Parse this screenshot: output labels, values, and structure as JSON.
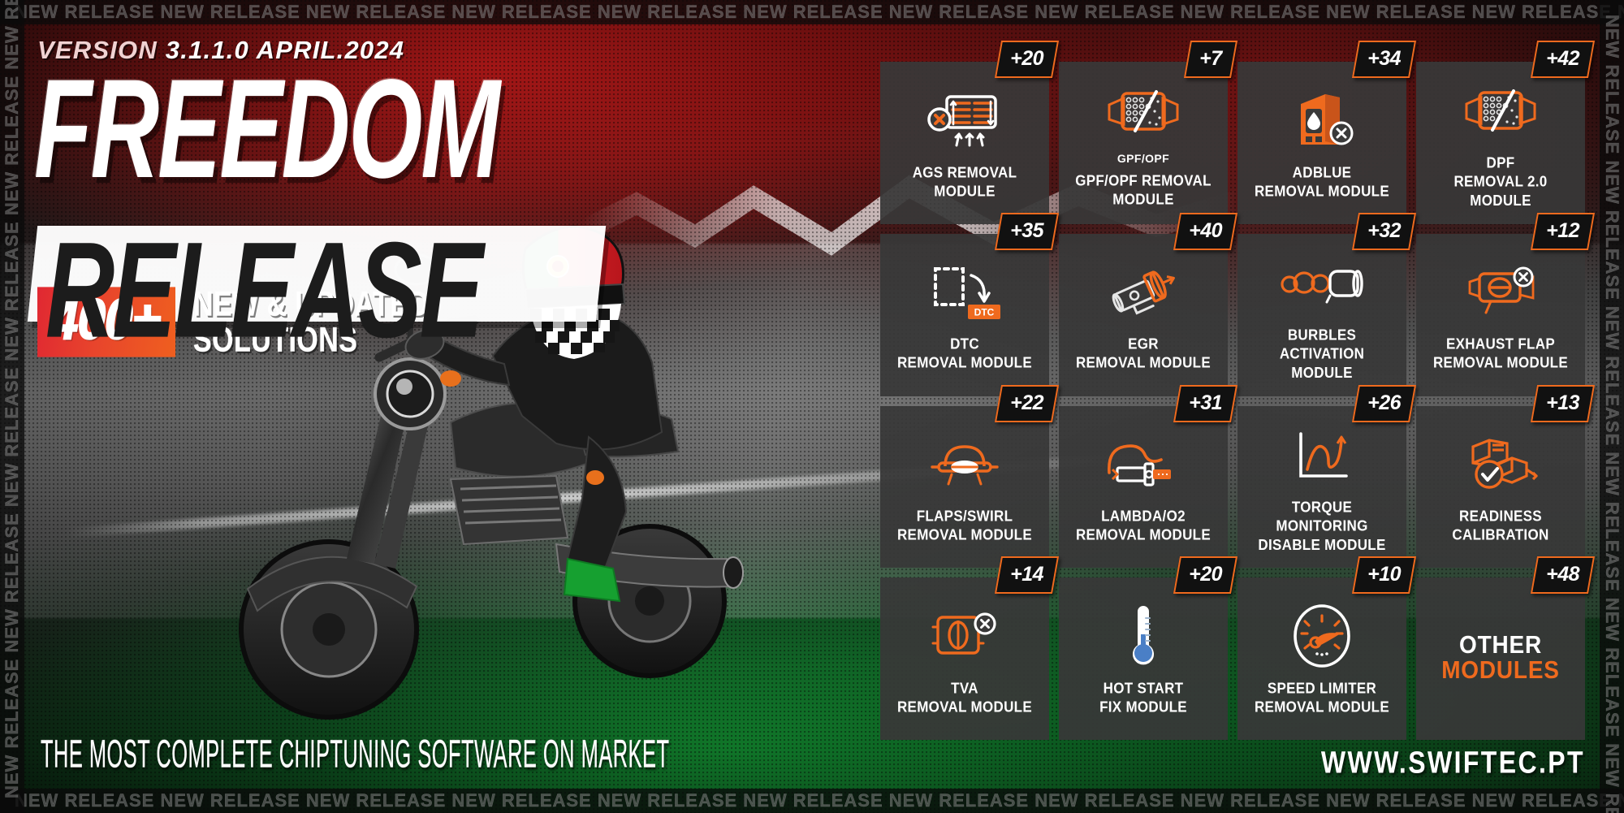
{
  "marquee": {
    "text": "NEW RELEASE NEW RELEASE NEW RELEASE NEW RELEASE NEW RELEASE NEW RELEASE NEW RELEASE NEW RELEASE NEW RELEASE NEW RELEASE NEW RELEASE NEW RELEASE NEW RELEASE NEW RELEASE NEW RELEASE NEW RELEASE NEW RELEASE NEW RELEASE NEW RELEASE NEW",
    "side_text": "NEW RELEASE NEW RELEASE NEW RELEASE NEW RELEASE NEW RELEASE NEW RELEASE NEW RELEASE NEW RELEASE NEW RELEASE NEW RELEASE"
  },
  "header": {
    "version_word": "VERSION",
    "version_number": "3.1.1.0",
    "version_date": "APRIL.2024",
    "title_line1": "FREEDOM",
    "title_line2": "RELEASE"
  },
  "highlight": {
    "count": "400+",
    "label_line1": "NEW & UPDATED",
    "label_line2": "SOLUTIONS"
  },
  "footer": {
    "tagline": "THE MOST COMPLETE CHIPTUNING SOFTWARE ON MARKET",
    "url": "WWW.SWIFTEC.PT"
  },
  "colors": {
    "accent_orange": "#ef6a1e",
    "accent_red": "#e02832",
    "card_bg": "#383838",
    "badge_bg": "#111111",
    "text_white": "#ffffff",
    "brand_green": "#128c30"
  },
  "modules": [
    {
      "icon": "ags-grille-icon",
      "badge": "+20",
      "label_line1": "AGS REMOVAL",
      "label_line2": "MODULE",
      "sublabel": ""
    },
    {
      "icon": "gpf-opf-filter-icon",
      "badge": "+7",
      "label_line1": "GPF/OPF REMOVAL",
      "label_line2": "MODULE",
      "sublabel": "GPF/OPF"
    },
    {
      "icon": "adblue-canister-icon",
      "badge": "+34",
      "label_line1": "ADBLUE",
      "label_line2": "REMOVAL MODULE",
      "sublabel": ""
    },
    {
      "icon": "dpf-filter-icon",
      "badge": "+42",
      "label_line1": "DPF",
      "label_line2": "REMOVAL 2.0 MODULE",
      "sublabel": ""
    },
    {
      "icon": "dtc-code-icon",
      "badge": "+35",
      "label_line1": "DTC",
      "label_line2": "REMOVAL MODULE",
      "sublabel": ""
    },
    {
      "icon": "egr-valve-icon",
      "badge": "+40",
      "label_line1": "EGR",
      "label_line2": "REMOVAL MODULE",
      "sublabel": ""
    },
    {
      "icon": "burbles-exhaust-icon",
      "badge": "+32",
      "label_line1": "BURBLES ACTIVATION",
      "label_line2": "MODULE",
      "sublabel": ""
    },
    {
      "icon": "exhaust-flap-icon",
      "badge": "+12",
      "label_line1": "EXHAUST FLAP",
      "label_line2": "REMOVAL MODULE",
      "sublabel": ""
    },
    {
      "icon": "flaps-swirl-icon",
      "badge": "+22",
      "label_line1": "FLAPS/SWIRL",
      "label_line2": "REMOVAL MODULE",
      "sublabel": ""
    },
    {
      "icon": "lambda-o2-sensor-icon",
      "badge": "+31",
      "label_line1": "LAMBDA/O2",
      "label_line2": "REMOVAL MODULE",
      "sublabel": ""
    },
    {
      "icon": "torque-graph-icon",
      "badge": "+26",
      "label_line1": "TORQUE MONITORING",
      "label_line2": "DISABLE MODULE",
      "sublabel": ""
    },
    {
      "icon": "readiness-connector-icon",
      "badge": "+13",
      "label_line1": "READINESS",
      "label_line2": "CALIBRATION",
      "sublabel": ""
    },
    {
      "icon": "tva-throttle-icon",
      "badge": "+14",
      "label_line1": "TVA",
      "label_line2": "REMOVAL MODULE",
      "sublabel": ""
    },
    {
      "icon": "thermometer-icon",
      "badge": "+20",
      "label_line1": "HOT START",
      "label_line2": "FIX MODULE",
      "sublabel": ""
    },
    {
      "icon": "speedometer-icon",
      "badge": "+10",
      "label_line1": "SPEED LIMITER",
      "label_line2": "REMOVAL MODULE",
      "sublabel": ""
    },
    {
      "icon": "other-modules-icon",
      "badge": "+48",
      "label_line1": "OTHER",
      "label_line2": "MODULES",
      "sublabel": "",
      "is_other": true
    }
  ]
}
